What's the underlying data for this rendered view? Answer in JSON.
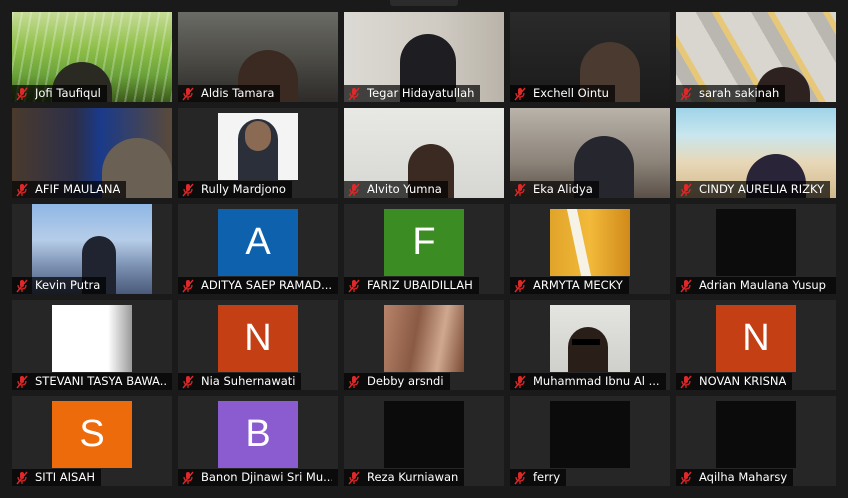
{
  "colors": {
    "mic_red": "#e02828",
    "avatar_blue": "#0e62ad",
    "avatar_green": "#3c8c24",
    "avatar_red": "#c43f14",
    "avatar_orange": "#ee6b0b",
    "avatar_purple": "#8a5cd0"
  },
  "participants": [
    {
      "name": "Jofi Taufiqul"
    },
    {
      "name": "Aldis Tamara"
    },
    {
      "name": "Tegar Hidayatullah"
    },
    {
      "name": "Exchell Ointu"
    },
    {
      "name": "sarah sakinah"
    },
    {
      "name": "AFIF MAULANA"
    },
    {
      "name": "Rully Mardjono"
    },
    {
      "name": "Alvito Yumna"
    },
    {
      "name": "Eka Alidya"
    },
    {
      "name": "CINDY AURELIA RIZKY"
    },
    {
      "name": "Kevin Putra"
    },
    {
      "name": "ADITYA SAEP RAMAD...",
      "avatar_letter": "A"
    },
    {
      "name": "FARIZ UBAIDILLAH",
      "avatar_letter": "F"
    },
    {
      "name": "ARMYTA MECKY"
    },
    {
      "name": "Adrian Maulana Yusup"
    },
    {
      "name": "STEVANI TASYA BAWA..."
    },
    {
      "name": "Nia Suhernawati",
      "avatar_letter": "N"
    },
    {
      "name": "Debby arsndi"
    },
    {
      "name": "Muhammad Ibnu Al ..."
    },
    {
      "name": "NOVAN KRISNA",
      "avatar_letter": "N"
    },
    {
      "name": "SITI AISAH",
      "avatar_letter": "S"
    },
    {
      "name": "Banon Djinawi Sri Mu...",
      "avatar_letter": "B"
    },
    {
      "name": "Reza Kurniawan"
    },
    {
      "name": "ferry"
    },
    {
      "name": "Aqilha Maharsy"
    }
  ]
}
